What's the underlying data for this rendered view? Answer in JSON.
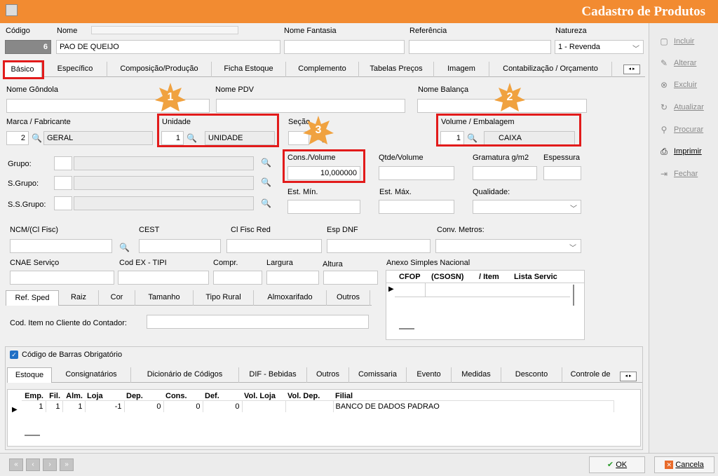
{
  "window": {
    "title": "Cadastro de Produtos"
  },
  "header": {
    "codigo_label": "Código",
    "codigo_value": "6",
    "nome_label": "Nome",
    "nome_value": "PAO DE QUEIJO",
    "fantasia_label": "Nome Fantasia",
    "referencia_label": "Referência",
    "natureza_label": "Natureza",
    "natureza_value": "1 - Revenda"
  },
  "main_tabs": [
    "Básico",
    "Específico",
    "Composição/Produção",
    "Ficha Estoque",
    "Complemento",
    "Tabelas Preços",
    "Imagem",
    "Contabilização / Orçamento"
  ],
  "basic": {
    "nome_gondola": "Nome Gôndola",
    "nome_pdv": "Nome PDV",
    "nome_balanca": "Nome Balança",
    "marca_label": "Marca / Fabricante",
    "marca_code": "2",
    "marca_name": "GERAL",
    "unidade_label": "Unidade",
    "unidade_code": "1",
    "unidade_name": "UNIDADE",
    "secao_label": "Seção",
    "volume_label": "Volume / Embalagem",
    "volume_code": "1",
    "volume_name": "CAIXA",
    "grupo": "Grupo:",
    "sgrupo": "S.Grupo:",
    "ssgrupo": "S.S.Grupo:",
    "cons_volume_label": "Cons./Volume",
    "cons_volume_value": "10,000000",
    "qtde_volume": "Qtde/Volume",
    "gramatura": "Gramatura g/m2",
    "espessura": "Espessura",
    "est_min": "Est. Mín.",
    "est_max": "Est. Máx.",
    "qualidade": "Qualidade:",
    "ncm": "NCM/(Cl Fisc)",
    "cest": "CEST",
    "cl_fisc_red": "Cl Fisc Red",
    "esp_dnf": "Esp DNF",
    "conv_metros": "Conv. Metros:",
    "cnae": "CNAE Serviço",
    "cod_ex": "Cod EX - TIPI",
    "compr": "Compr.",
    "largura": "Largura",
    "altura": "Altura",
    "anexo": "Anexo Simples Nacional",
    "anexo_cols": [
      "CFOP",
      "(CSOSN)",
      "/ Item",
      "Lista Servic"
    ],
    "cod_item_cliente": "Cod. Item no Cliente do Contador:"
  },
  "sub_tabs": [
    "Ref. Sped",
    "Raiz",
    "Cor",
    "Tamanho",
    "Tipo Rural",
    "Almoxarifado",
    "Outros"
  ],
  "badges": [
    "1",
    "2",
    "3"
  ],
  "barcode": {
    "label": "Código de Barras Obrigatório",
    "checked": true
  },
  "lower_tabs": [
    "Estoque",
    "Consignatários",
    "Dicionário de Códigos",
    "DIF - Bebidas",
    "Outros",
    "Comissaria",
    "Evento",
    "Medidas",
    "Desconto",
    "Controle de"
  ],
  "stock_table": {
    "columns": [
      "Emp.",
      "Fil.",
      "Alm.",
      "Loja",
      "Dep.",
      "Cons.",
      "Def.",
      "Vol. Loja",
      "Vol. Dep.",
      "Filial"
    ],
    "rows": [
      [
        "1",
        "1",
        "1",
        "-1",
        "0",
        "0",
        "0",
        "",
        "",
        "BANCO DE DADOS PADRAO"
      ]
    ]
  },
  "side_buttons": [
    "Incluir",
    "Alterar",
    "Excluir",
    "Atualizar",
    "Procurar",
    "Imprimir",
    "Fechar"
  ],
  "footer": {
    "ok": "OK",
    "cancel": "Cancela"
  },
  "colors": {
    "titlebar": "#f28b31",
    "highlight": "#e21b1b",
    "badge": "#f0a240"
  }
}
